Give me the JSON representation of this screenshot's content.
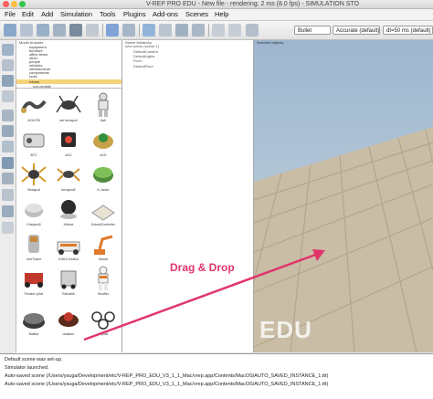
{
  "window": {
    "title": "V-REP PRO EDU - New file - rendering: 2 ms (8.0 fps) - SIMULATION STO"
  },
  "menu": [
    "File",
    "Edit",
    "Add",
    "Simulation",
    "Tools",
    "Plugins",
    "Add-ons",
    "Scenes",
    "Help"
  ],
  "toolbar": {
    "physics_engine": "Bullet",
    "accuracy": "Accurate (default)",
    "timestep": "dt=50 ms (default)"
  },
  "model_browser": {
    "header": "Model browser",
    "tree_items": [
      "equipment",
      "furniture",
      "office items",
      "other",
      "people",
      "vehicles",
      "infrastructure",
      "components",
      "tools",
      "robots",
      "non-mobile",
      "mobile",
      "examples"
    ],
    "selected": "robots",
    "thumbnails": [
      {
        "label": "ACM-R5"
      },
      {
        "label": "ant hexapod"
      },
      {
        "label": "Asti"
      },
      {
        "label": "BTC"
      },
      {
        "label": "dr12"
      },
      {
        "label": "dr20"
      },
      {
        "label": "Hexapod"
      },
      {
        "label": "hexapod2"
      },
      {
        "label": "K-Junior"
      },
      {
        "label": "Khepera3"
      },
      {
        "label": "Kilobot"
      },
      {
        "label": "KobukiController"
      },
      {
        "label": "LineTracer"
      },
      {
        "label": "KUKA YouBot"
      },
      {
        "label": "Manta"
      },
      {
        "label": "Pioneer p3dx"
      },
      {
        "label": "Robotnik"
      },
      {
        "label": "Shuffler"
      },
      {
        "label": "Ballbot"
      },
      {
        "label": "dualarm"
      },
      {
        "label": "e-puck"
      }
    ]
  },
  "scene_hierarchy": {
    "header": "Scene hierarchy",
    "rows": [
      "new scene (scene 1)",
      "DefaultCamera",
      "DefaultLights",
      "Floor",
      "DefaultFloor"
    ]
  },
  "scene_view": {
    "header": "Selected objects",
    "watermark": "EDU"
  },
  "annotation": {
    "text": "Drag & Drop",
    "color": "#e0356a"
  },
  "console": {
    "lines": [
      "Default scene was set-up.",
      "Simulator launched.",
      "Auto-saved scene (/Users/ysuga/Development/etc/V-REP_PRO_EDU_V3_1_1_Mac/vrep.app/Contents/MacOS/AUTO_SAVED_INSTANCE_1.ttt)",
      "Auto-saved scene (/Users/ysuga/Development/etc/V-REP_PRO_EDU_V3_1_1_Mac/vrep.app/Contents/MacOS/AUTO_SAVED_INSTANCE_1.ttt)"
    ]
  }
}
